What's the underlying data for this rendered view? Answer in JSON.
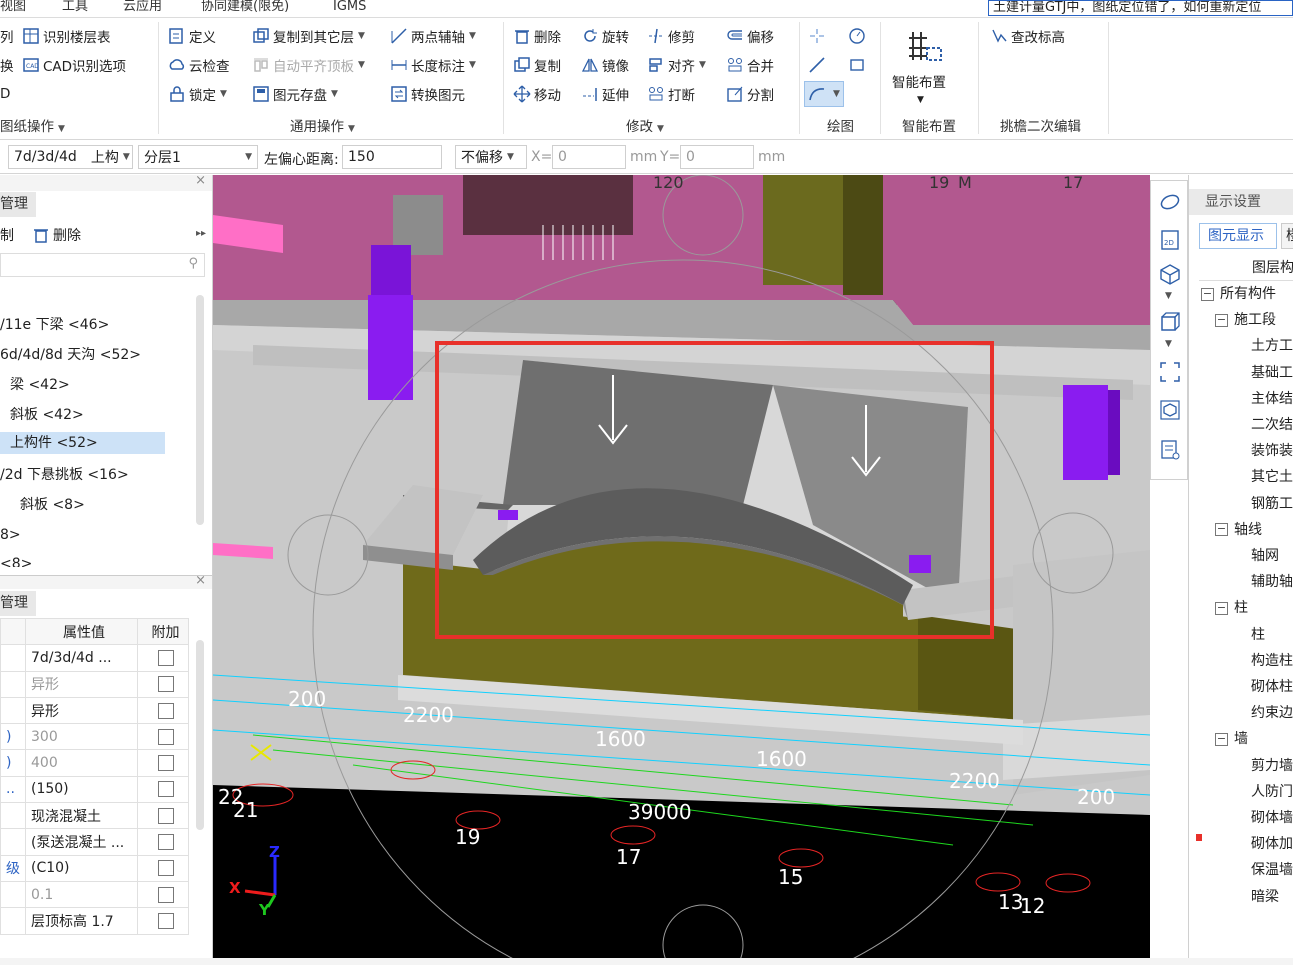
{
  "menubar": {
    "items": [
      "视图",
      "工具",
      "云应用",
      "协同建模(限免)",
      "IGMS"
    ],
    "news": "土建计量GTJ中，图纸定位错了，如何重新定位"
  },
  "ribbon": {
    "drawing_ops": {
      "row1": "识别楼层表",
      "row2": "CAD识别选项",
      "stub1": "列",
      "stub2": "换",
      "stub3": "D",
      "label": "图纸操作"
    },
    "general_ops": {
      "define": "定义",
      "cloud_check": "云检查",
      "lock": "锁定",
      "copy_to_layer": "复制到其它层",
      "auto_align": "自动平齐顶板",
      "save_element": "图元存盘",
      "two_point_axis": "两点辅轴",
      "length_dim": "长度标注",
      "convert": "转换图元",
      "label": "通用操作"
    },
    "modify": {
      "delete": "删除",
      "rotate": "旋转",
      "trim": "修剪",
      "offset": "偏移",
      "copy": "复制",
      "mirror": "镜像",
      "align": "对齐",
      "merge": "合并",
      "move": "移动",
      "extend": "延伸",
      "break": "打断",
      "split": "分割",
      "label": "修改"
    },
    "draw": {
      "label": "绘图"
    },
    "smart": {
      "button": "智能布置",
      "label": "智能布置"
    },
    "eave": {
      "button": "查改标高",
      "label": "挑檐二次编辑"
    }
  },
  "params": {
    "field1": "7d/3d/4d",
    "field2": "上构",
    "layer": "分层1",
    "offset_label": "左偏心距离:",
    "offset_value": "150",
    "nooffset": "不偏移",
    "x_label": "X=",
    "x_value": "0",
    "unit1": "mm",
    "y_label": "Y=",
    "y_value": "0",
    "unit2": "mm"
  },
  "left": {
    "panel1_title": "管理",
    "copy_stub": "制",
    "delete": "删除",
    "tree": [
      "/11e  下梁 <46>",
      "6d/4d/8d  天沟 <52>",
      "梁 <42>",
      "斜板 <42>",
      "上构件 <52>",
      "/2d  下悬挑板 <16>",
      "斜板 <8>",
      "8>",
      "<8>"
    ],
    "panel2_title": "管理",
    "prop_headers": [
      "属性值",
      "附加"
    ],
    "props": [
      {
        "k": "",
        "v": "7d/3d/4d  ...",
        "dim": false
      },
      {
        "k": "",
        "v": "异形",
        "dim": true
      },
      {
        "k": "",
        "v": "异形",
        "dim": false
      },
      {
        "k": ")",
        "v": "300",
        "dim": true
      },
      {
        "k": ")",
        "v": "400",
        "dim": true
      },
      {
        "k": "..",
        "v": "(150)",
        "dim": false
      },
      {
        "k": "",
        "v": "现浇混凝土",
        "dim": false
      },
      {
        "k": "",
        "v": "(泵送混凝土 ...",
        "dim": false
      },
      {
        "k": "级",
        "v": "(C10)",
        "dim": false
      },
      {
        "k": "",
        "v": "0.1",
        "dim": true
      },
      {
        "k": "",
        "v": "层顶标高 1.7",
        "dim": false
      }
    ]
  },
  "viewport": {
    "dims": [
      "200",
      "2200",
      "1600",
      "1600",
      "2200",
      "200",
      "39000"
    ],
    "axes": [
      "22",
      "21",
      "19",
      "17",
      "15",
      "13",
      "12"
    ],
    "top_labels": [
      "120",
      "19",
      "M",
      "17"
    ],
    "axis_x": "X",
    "axis_y": "Y",
    "axis_z": "Z"
  },
  "right": {
    "title": "显示设置",
    "tab_active": "图元显示",
    "tab_other": "楼",
    "col_header": "图层构",
    "items": [
      {
        "t": "所有构件",
        "lvl": 0,
        "box": true
      },
      {
        "t": "施工段",
        "lvl": 1,
        "box": true
      },
      {
        "t": "土方工",
        "lvl": 2,
        "box": false
      },
      {
        "t": "基础工",
        "lvl": 2,
        "box": false
      },
      {
        "t": "主体结",
        "lvl": 2,
        "box": false
      },
      {
        "t": "二次结",
        "lvl": 2,
        "box": false
      },
      {
        "t": "装饰装",
        "lvl": 2,
        "box": false
      },
      {
        "t": "其它土",
        "lvl": 2,
        "box": false
      },
      {
        "t": "钢筋工",
        "lvl": 2,
        "box": false
      },
      {
        "t": "轴线",
        "lvl": 1,
        "box": true
      },
      {
        "t": "轴网",
        "lvl": 2,
        "box": false
      },
      {
        "t": "辅助轴",
        "lvl": 2,
        "box": false
      },
      {
        "t": "柱",
        "lvl": 1,
        "box": true
      },
      {
        "t": "柱",
        "lvl": 2,
        "box": false
      },
      {
        "t": "构造柱",
        "lvl": 2,
        "box": false
      },
      {
        "t": "砌体柱",
        "lvl": 2,
        "box": false
      },
      {
        "t": "约束边",
        "lvl": 2,
        "box": false
      },
      {
        "t": "墙",
        "lvl": 1,
        "box": true
      },
      {
        "t": "剪力墙",
        "lvl": 2,
        "box": false
      },
      {
        "t": "人防门",
        "lvl": 2,
        "box": false
      },
      {
        "t": "砌体墙",
        "lvl": 2,
        "box": false
      },
      {
        "t": "砌体加",
        "lvl": 2,
        "box": false
      },
      {
        "t": "保温墙",
        "lvl": 2,
        "box": false
      },
      {
        "t": "暗梁",
        "lvl": 2,
        "box": false
      }
    ]
  },
  "colors": {
    "highlight": "#e8302a",
    "slab": "#b2588f",
    "pink": "#ff6fc6",
    "purple": "#8a1cf0",
    "olive": "#6f6a1a",
    "grey": "#c9c9c9"
  }
}
